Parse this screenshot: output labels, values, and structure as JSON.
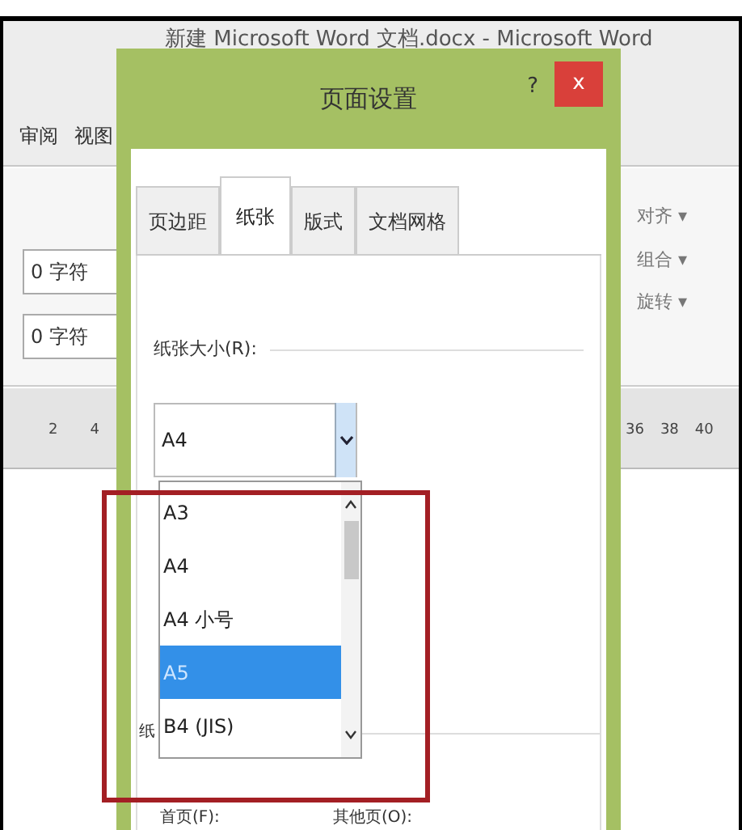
{
  "window": {
    "title": "新建 Microsoft Word 文档.docx - Microsoft Word"
  },
  "ribbon": {
    "tabs": [
      {
        "label": "审阅",
        "selected": false
      },
      {
        "label": "视图",
        "selected": false
      }
    ],
    "indent_fields": [
      {
        "value": "0 字符"
      },
      {
        "value": "0 字符"
      }
    ],
    "arrange_buttons": [
      {
        "label": "对齐 ▾"
      },
      {
        "label": "组合 ▾"
      },
      {
        "label": "旋转 ▾"
      }
    ]
  },
  "ruler": {
    "left_numbers": [
      "2",
      "4"
    ],
    "right_numbers": [
      "36",
      "38",
      "40"
    ]
  },
  "dialog": {
    "title": "页面设置",
    "help": "?",
    "close": "x",
    "tabs": [
      {
        "label": "页边距",
        "selected": false
      },
      {
        "label": "纸张",
        "selected": true
      },
      {
        "label": "版式",
        "selected": false
      },
      {
        "label": "文档网格",
        "selected": false
      }
    ],
    "paper_size_label": "纸张大小(R):",
    "paper_size": {
      "value": "A4"
    },
    "options": [
      {
        "label": "A3",
        "selected": false
      },
      {
        "label": "A4",
        "selected": false
      },
      {
        "label": "A4 小号",
        "selected": false
      },
      {
        "label": "A5",
        "selected": true
      },
      {
        "label": "B4 (JIS)",
        "selected": false
      }
    ],
    "source_label": "纸",
    "first_page_label": "首页(F):",
    "other_pages_label": "其他页(O):"
  }
}
